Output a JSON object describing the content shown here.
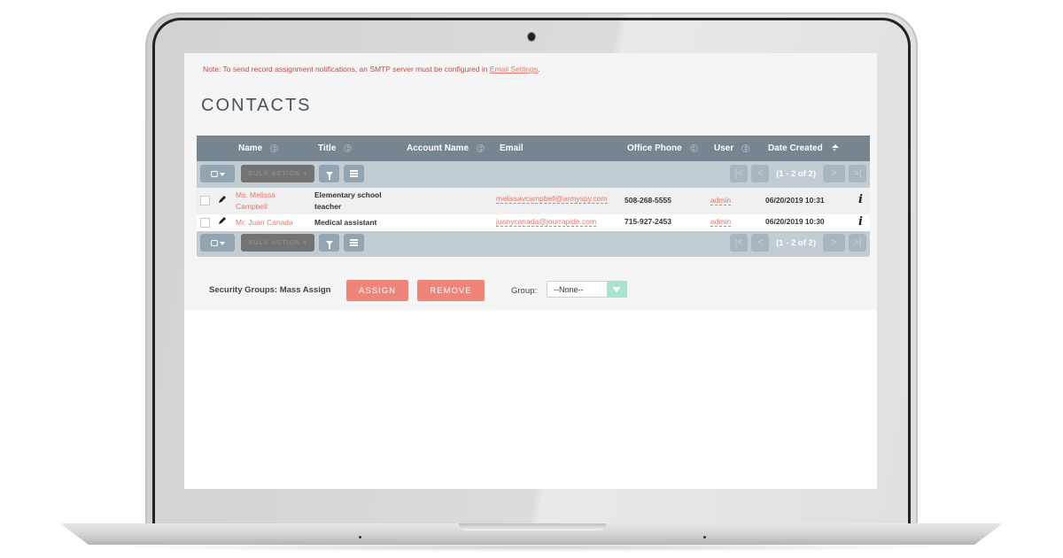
{
  "note": {
    "text": "Note: To send record assignment notifications, an SMTP server must be configured in ",
    "link": "Email Settings",
    "suffix": "."
  },
  "page_title": "CONTACTS",
  "table": {
    "columns": [
      {
        "label": "Name",
        "sortable": true,
        "active": false
      },
      {
        "label": "Title",
        "sortable": true,
        "active": false
      },
      {
        "label": "Account Name",
        "sortable": true,
        "active": false
      },
      {
        "label": "Email",
        "sortable": false,
        "active": false
      },
      {
        "label": "Office Phone",
        "sortable": true,
        "active": false
      },
      {
        "label": "User",
        "sortable": true,
        "active": false
      },
      {
        "label": "Date Created",
        "sortable": true,
        "active": true
      }
    ],
    "toolbar": {
      "bulk_action": "BULK ACTION",
      "bulk_caret": "▾",
      "pagination": "(1 - 2 of 2)",
      "first": "|<",
      "prev": "<",
      "next": ">",
      "last": ">|"
    },
    "rows": [
      {
        "name_line1": "Ms. Melissa",
        "name_line2": "Campbell",
        "title_line1": "Elementary school",
        "title_line2": "teacher",
        "account": "",
        "email": "melissavcampbell@armyspy.com",
        "phone": "508-268-5555",
        "user": "admin",
        "date_created": "06/20/2019 10:31",
        "info": "i"
      },
      {
        "name_line1": "Mr. Juan Canada",
        "name_line2": "",
        "title_line1": "Medical assistant",
        "title_line2": "",
        "account": "",
        "email": "juanycanada@jourrapide.com",
        "phone": "715-927-2453",
        "user": "admin",
        "date_created": "06/20/2019 10:30",
        "info": "i"
      }
    ]
  },
  "mass_assign": {
    "label": "Security Groups: Mass Assign",
    "assign": "ASSIGN",
    "remove": "REMOVE",
    "group_label": "Group:",
    "group_value": "--None--"
  },
  "colors": {
    "accent": "#ef8478",
    "link": "#e8776c",
    "header_bg": "#778591",
    "toolbar_bg": "#c1ccd3",
    "select_accent": "#a8e3d2"
  }
}
